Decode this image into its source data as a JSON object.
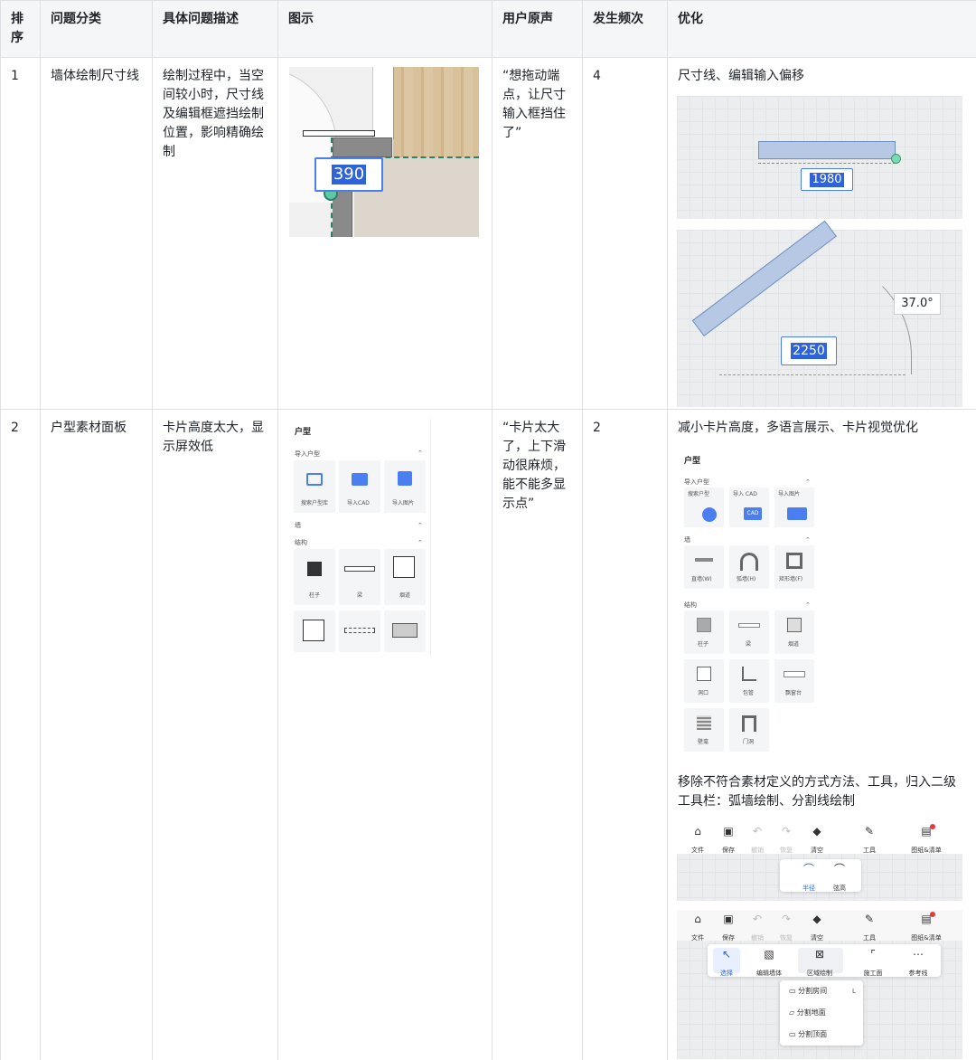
{
  "headers": [
    "排序",
    "问题分类",
    "具体问题描述",
    "图示",
    "用户原声",
    "发生频次",
    "优化"
  ],
  "rows": [
    {
      "index": "1",
      "category": "墙体绘制尺寸线",
      "description": "绘制过程中，当空间较小时，尺寸线及编辑框遮挡绘制位置，影响精确绘制",
      "figure": {
        "dim_value": "390"
      },
      "quote": "“想拖动端点，让尺寸输入框挡住了”",
      "frequency": "4",
      "optimization": {
        "text": "尺寸线、编辑输入偏移",
        "img1_value": "1980",
        "img2_value": "2250",
        "img2_angle": "37.0°"
      }
    },
    {
      "index": "2",
      "category": "户型素材面板",
      "description": "卡片高度太大，显示屏效低",
      "quote": "“卡片太大了，上下滑动很麻烦，能不能多显示点”",
      "frequency": "2",
      "figure": {
        "panel_title": "户型",
        "sec_import": "导入户型",
        "import_items": [
          "搜索户型库",
          "导入CAD",
          "导入图片"
        ],
        "sec_wall": "墙",
        "sec_struct": "结构",
        "struct_items": [
          "柱子",
          "梁",
          "烟道"
        ]
      },
      "optimization": {
        "text": "减小卡片高度，多语言展示、卡片视觉优化",
        "panel_title": "户型",
        "sec_import": "导入户型",
        "import_items": [
          "搜索户型",
          "导入 CAD",
          "导入图片"
        ],
        "cad_badge": "CAD",
        "sec_wall": "墙",
        "wall_items": [
          "直墙(W)",
          "弧墙(H)",
          "矩形墙(F)"
        ],
        "sec_struct": "结构",
        "struct_items": [
          "柱子",
          "梁",
          "烟道",
          "洞口",
          "包管",
          "飘窗台",
          "壁龛",
          "门洞"
        ],
        "text2": "移除不符合素材定义的方式方法、工具，归入二级工具栏：弧墙绘制、分割线绘制",
        "toolbar": [
          "文件",
          "保存",
          "撤销",
          "恢复",
          "清空",
          "工具",
          "图纸&清单"
        ],
        "sub_tools1": [
          "半径",
          "弦高"
        ],
        "sub_tools2": [
          "选择",
          "编辑墙体",
          "区域绘制",
          "施工面",
          "参考线"
        ],
        "dropdown": [
          "分割房间",
          "分割地面",
          "分割顶面"
        ],
        "dropdown_key": "L"
      }
    }
  ]
}
